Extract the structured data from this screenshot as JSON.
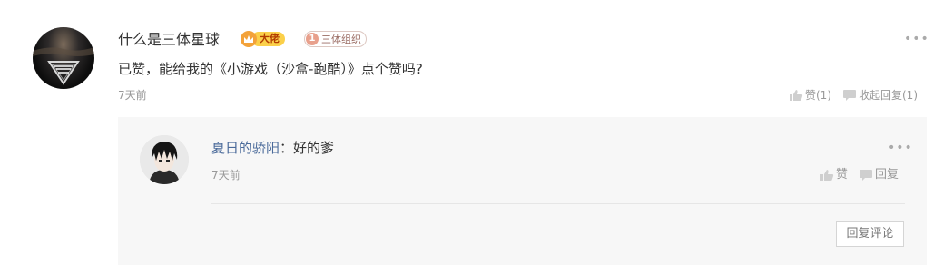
{
  "comment": {
    "username": "什么是三体星球",
    "badge_vip": "大佬",
    "badge_org_number": "1",
    "badge_org_label": "三体组织",
    "more": "•••",
    "text": "已赞，能给我的《小游戏（沙盒-跑酷）》点个赞吗?",
    "time": "7天前",
    "like_label": "赞(1)",
    "collapse_reply_label": "收起回复(1)"
  },
  "reply": {
    "username": "夏日的骄阳",
    "colon": "：",
    "text": "好的爹",
    "more": "•••",
    "time": "7天前",
    "like_label": "赞",
    "reply_label": "回复",
    "reply_comment_button": "回复评论"
  },
  "colors": {
    "vip_badge": "#fbd04a",
    "vip_crown": "#f3a23a",
    "reply_username": "#4a6a9a",
    "reply_background": "#f7f7f7"
  }
}
